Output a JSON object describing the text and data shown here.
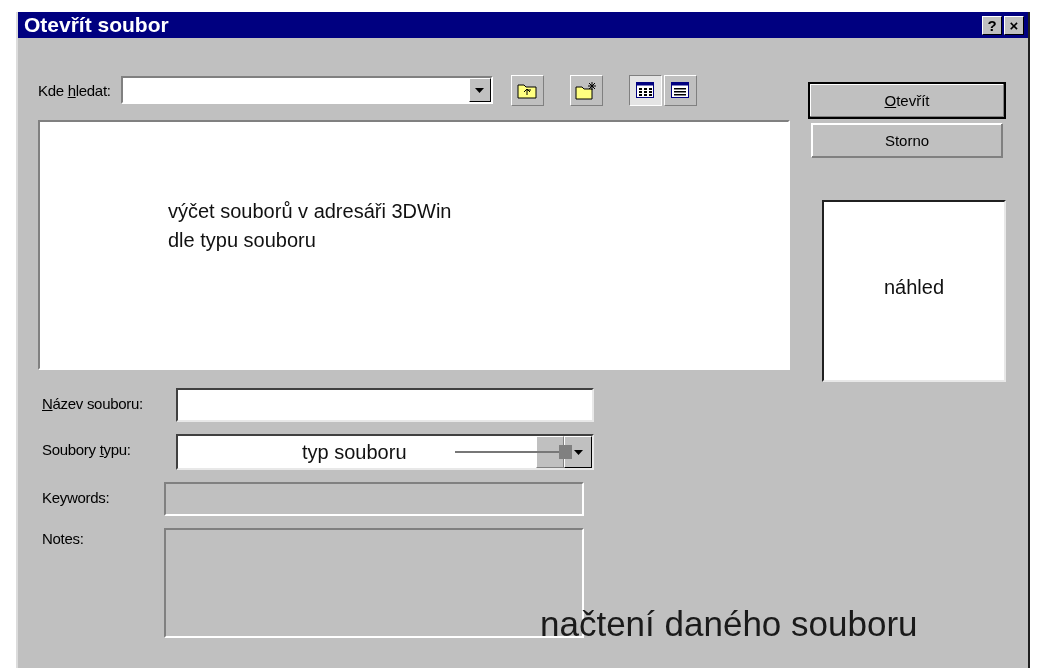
{
  "window": {
    "title": "Otevřít soubor",
    "title_buttons": [
      "?",
      "×"
    ]
  },
  "look_in": {
    "label_parts": [
      {
        "text": "Kde ",
        "underlined": false
      },
      {
        "text": "h",
        "underlined": true
      },
      {
        "text": "ledat:",
        "underlined": false
      }
    ]
  },
  "toolbar": [
    {
      "kind": "up-folder",
      "pressed": false
    },
    {
      "kind": "new-folder",
      "pressed": false
    },
    {
      "kind": "list-view",
      "pressed": true
    },
    {
      "kind": "details-view",
      "pressed": false
    }
  ],
  "file_list": {
    "annotation": [
      "výčet souborů v adresáři 3DWin",
      "dle typu souboru"
    ]
  },
  "fields": [
    {
      "kind": "text",
      "disabled": false,
      "label_parts": [
        {
          "text": "N",
          "underlined": true
        },
        {
          "text": "ázev souboru:",
          "underlined": false
        }
      ]
    },
    {
      "kind": "combo",
      "disabled": false,
      "annotation": "typ souboru",
      "label_parts": [
        {
          "text": "Soubory ",
          "underlined": false
        },
        {
          "text": "t",
          "underlined": true
        },
        {
          "text": "ypu:",
          "underlined": false
        }
      ]
    },
    {
      "kind": "text",
      "disabled": true,
      "label_parts": [
        {
          "text": "Keywords:",
          "underlined": false
        }
      ]
    },
    {
      "kind": "memo",
      "disabled": true,
      "label_parts": [
        {
          "text": "Notes:",
          "underlined": false
        }
      ]
    }
  ],
  "buttons": [
    {
      "default": true,
      "label_parts": [
        {
          "text": "O",
          "underlined": true
        },
        {
          "text": "tevřít",
          "underlined": false
        }
      ]
    },
    {
      "default": false,
      "label_parts": [
        {
          "text": "Storno",
          "underlined": false
        }
      ]
    }
  ],
  "preview": {
    "annotation": "náhled"
  },
  "annotation": "načtení daného souboru"
}
